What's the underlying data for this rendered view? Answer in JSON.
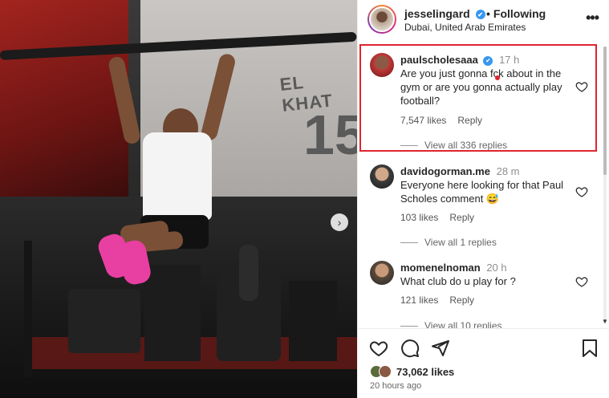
{
  "post": {
    "username": "jesselingard",
    "follow_status": "Following",
    "location": "Dubai, United Arab Emirates",
    "poster_text": "EL KHAT",
    "poster_number": "15"
  },
  "comments": [
    {
      "username": "paulscholesaaa",
      "verified": true,
      "time": "17 h",
      "text": "Are you just gonna fck about in the gym or are you gonna actually play football?",
      "likes": "7,547 likes",
      "reply_label": "Reply",
      "view_replies": "View all 336 replies"
    },
    {
      "username": "davidogorman.me",
      "verified": false,
      "time": "28 m",
      "text": "Everyone here looking for that Paul Scholes comment 😅",
      "likes": "103 likes",
      "reply_label": "Reply",
      "view_replies": "View all 1 replies"
    },
    {
      "username": "momenelnoman",
      "verified": false,
      "time": "20 h",
      "text": "What club do u play for ?",
      "likes": "121 likes",
      "reply_label": "Reply",
      "view_replies": "View all 10 replies"
    }
  ],
  "footer": {
    "likes_count": "73,062 likes",
    "posted_time": "20 hours ago"
  },
  "icons": {
    "verified": "✔",
    "more": "•••",
    "next": "›"
  },
  "colors": {
    "highlight_border": "#e0252f",
    "verified_blue": "#3897f0",
    "shoe_pink": "#e83fa2"
  }
}
